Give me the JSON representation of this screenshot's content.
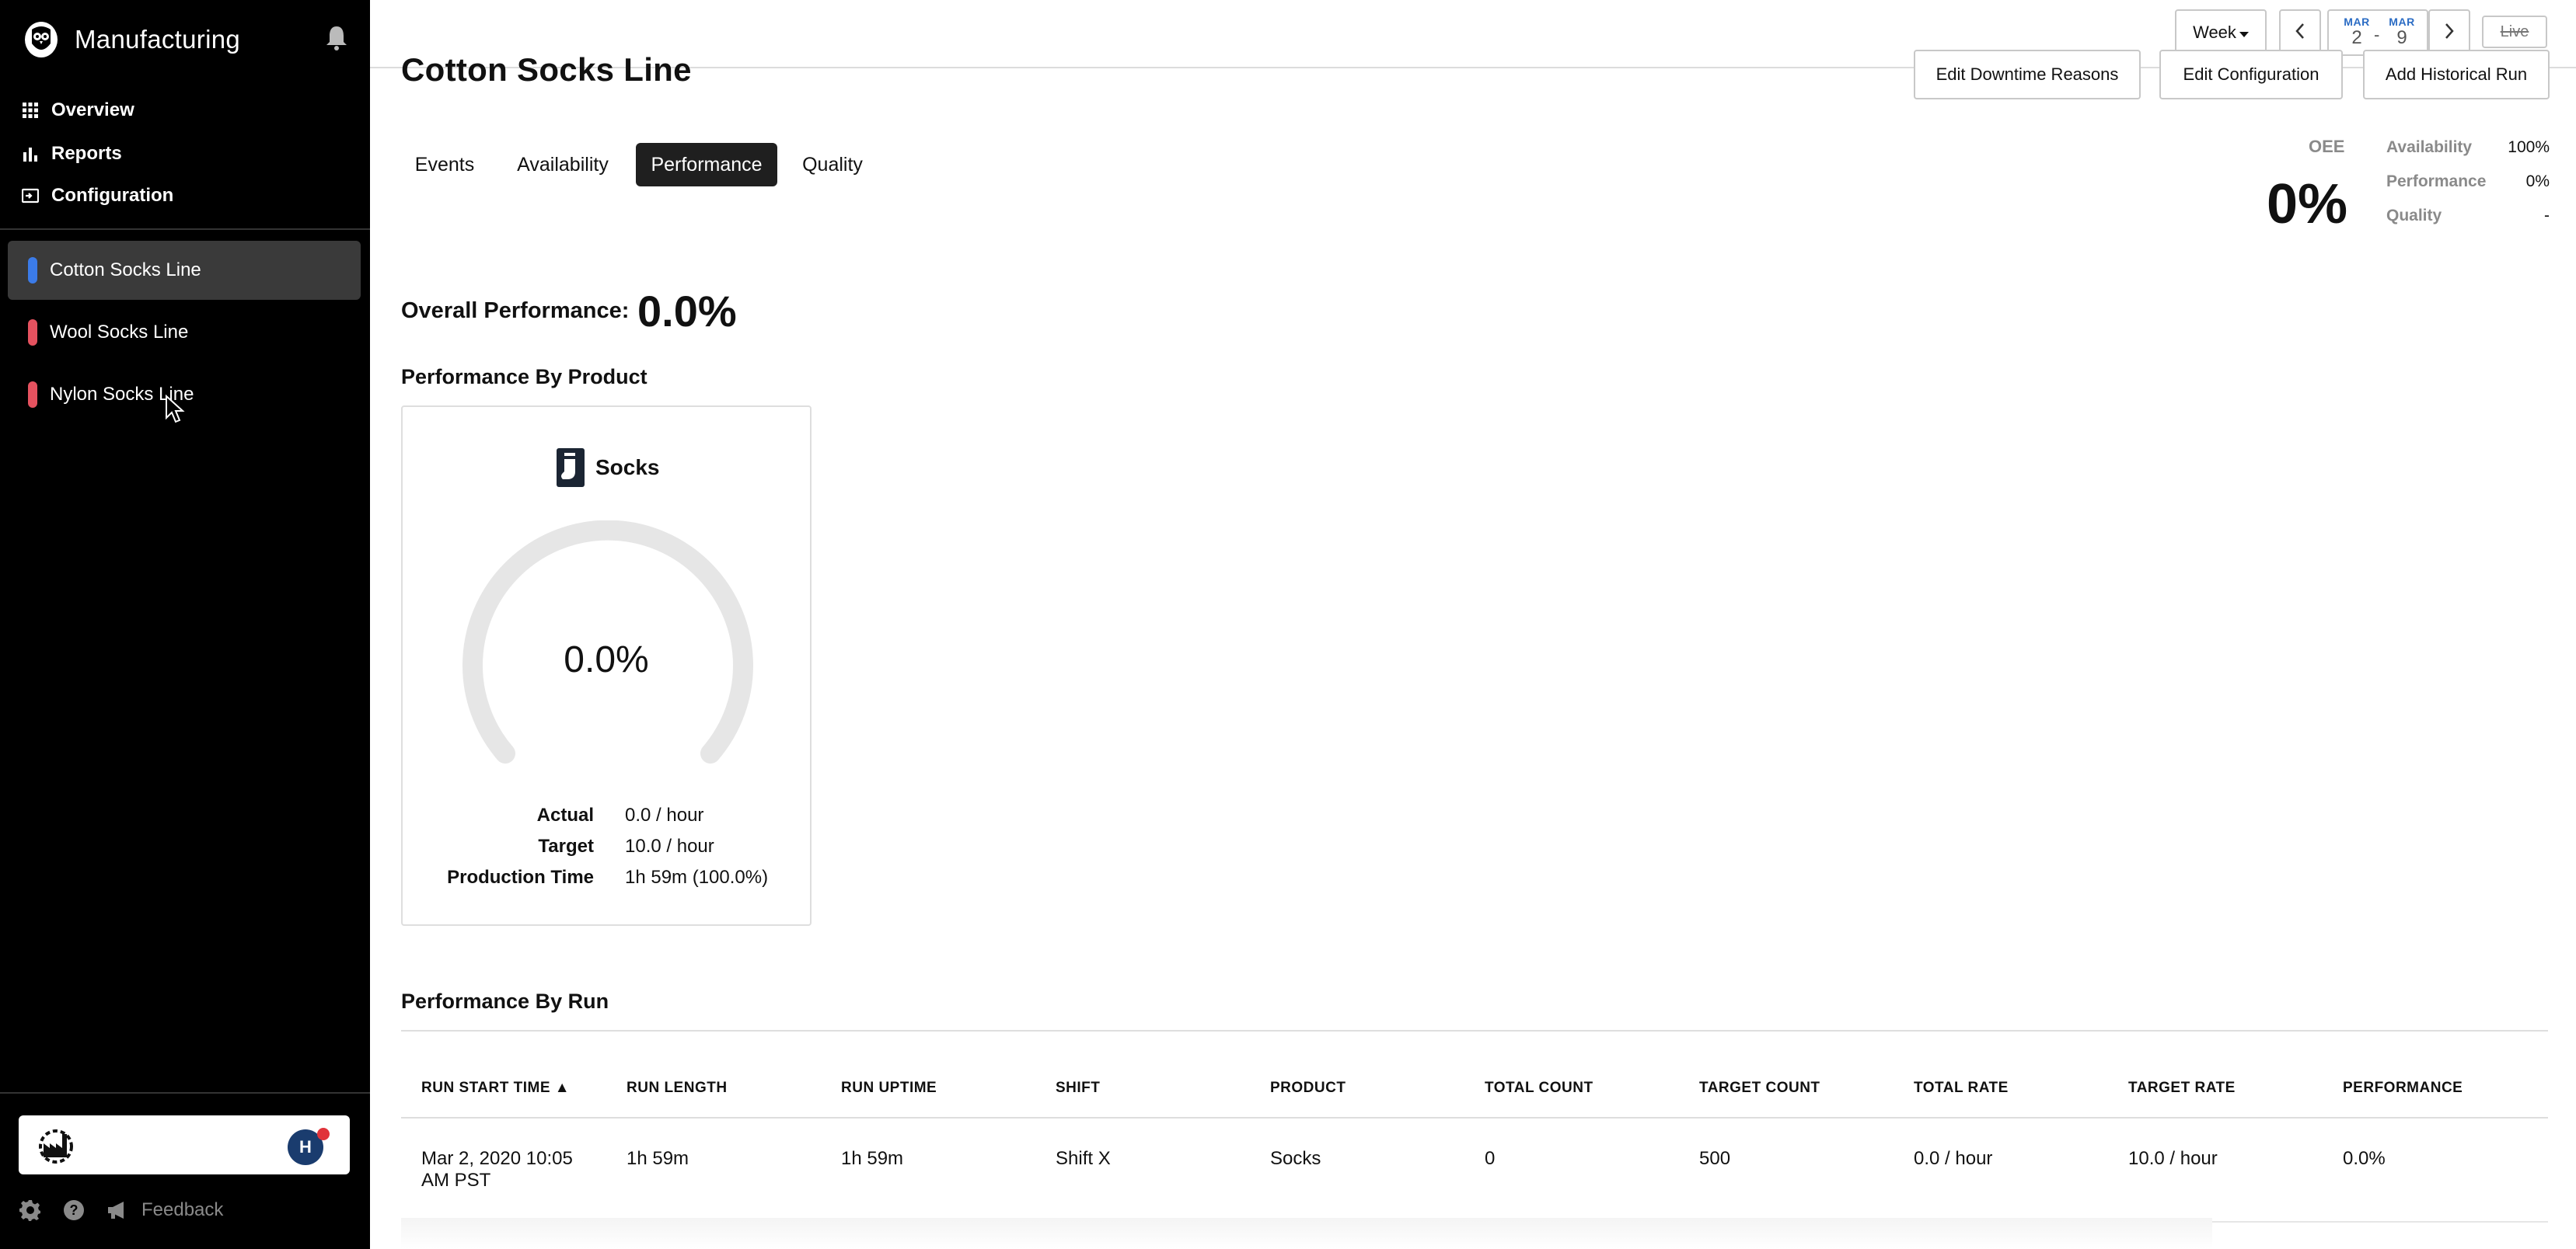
{
  "app": {
    "title": "Manufacturing"
  },
  "nav": [
    {
      "label": "Overview",
      "icon": "grid-icon"
    },
    {
      "label": "Reports",
      "icon": "bar-chart-icon"
    },
    {
      "label": "Configuration",
      "icon": "config-icon"
    }
  ],
  "lines": [
    {
      "label": "Cotton Socks Line",
      "color": "#3b7be8",
      "active": true
    },
    {
      "label": "Wool Socks Line",
      "color": "#e5525f",
      "active": false
    },
    {
      "label": "Nylon Socks Line",
      "color": "#e5525f",
      "active": false
    }
  ],
  "user": {
    "initial": "H"
  },
  "footer": {
    "feedback_label": "Feedback"
  },
  "topbar": {
    "period": "Week",
    "start_month": "MAR",
    "start_day": "2",
    "end_month": "MAR",
    "end_day": "9",
    "date_sep": "-",
    "live_label": "Live"
  },
  "page": {
    "title": "Cotton Socks Line",
    "actions": {
      "downtime": "Edit Downtime Reasons",
      "config": "Edit Configuration",
      "historical": "Add Historical Run"
    },
    "tabs": [
      "Events",
      "Availability",
      "Performance",
      "Quality"
    ],
    "active_tab": "Performance"
  },
  "oee": {
    "label": "OEE",
    "value": "0%",
    "rows": [
      {
        "label": "Availability",
        "value": "100%"
      },
      {
        "label": "Performance",
        "value": "0%"
      },
      {
        "label": "Quality",
        "value": "-"
      }
    ]
  },
  "overall": {
    "label": "Overall Performance:",
    "value": "0.0%"
  },
  "by_product": {
    "title": "Performance By Product",
    "product": "Socks",
    "gauge_value": "0.0%",
    "gauge_fraction": 0.0,
    "stats": [
      {
        "label": "Actual",
        "value": "0.0 / hour"
      },
      {
        "label": "Target",
        "value": "10.0 / hour"
      },
      {
        "label": "Production Time",
        "value": "1h 59m (100.0%)"
      }
    ]
  },
  "by_run": {
    "title": "Performance By Run",
    "columns": [
      "RUN START TIME ▲",
      "RUN LENGTH",
      "RUN UPTIME",
      "SHIFT",
      "PRODUCT",
      "TOTAL COUNT",
      "TARGET COUNT",
      "TOTAL RATE",
      "TARGET RATE",
      "PERFORMANCE"
    ],
    "rows": [
      {
        "start_line1": "Mar 2, 2020 10:05",
        "start_line2": "AM PST",
        "length": "1h 59m",
        "uptime": "1h 59m",
        "shift": "Shift X",
        "product": "Socks",
        "total_count": "0",
        "target_count": "500",
        "total_rate": "0.0 / hour",
        "target_rate": "10.0 / hour",
        "performance": "0.0%"
      }
    ]
  }
}
